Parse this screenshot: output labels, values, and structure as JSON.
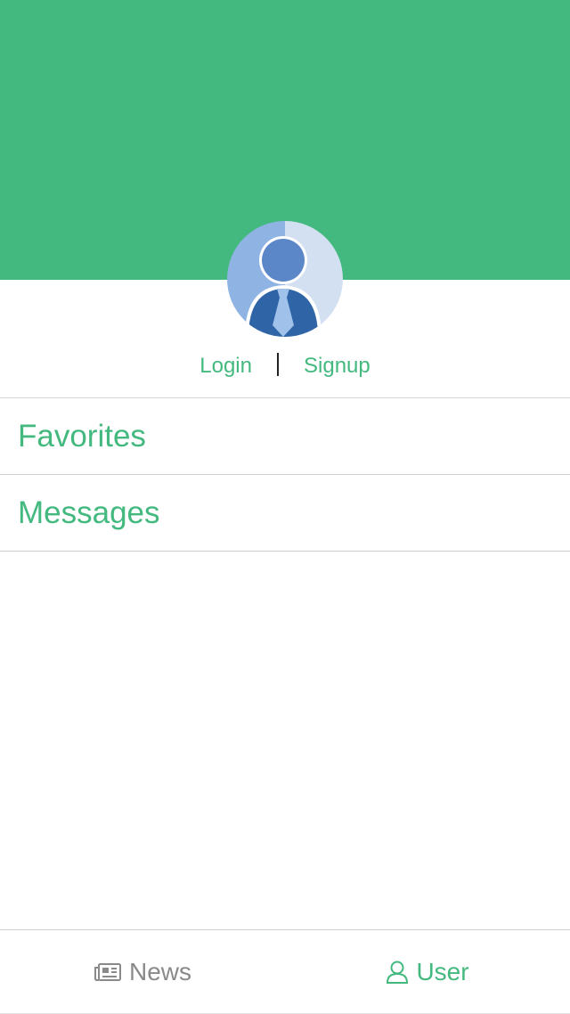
{
  "colors": {
    "accent": "#43b97f",
    "inactive_tab": "#8a8a8a",
    "divider": "#cfcfcf"
  },
  "profile": {
    "avatar_icon": "user-avatar-icon",
    "login_label": "Login",
    "signup_label": "Signup"
  },
  "menu": {
    "items": [
      {
        "label": "Favorites"
      },
      {
        "label": "Messages"
      }
    ]
  },
  "tabbar": {
    "tabs": [
      {
        "label": "News",
        "icon": "newspaper-icon",
        "active": false
      },
      {
        "label": "User",
        "icon": "user-icon",
        "active": true
      }
    ]
  }
}
